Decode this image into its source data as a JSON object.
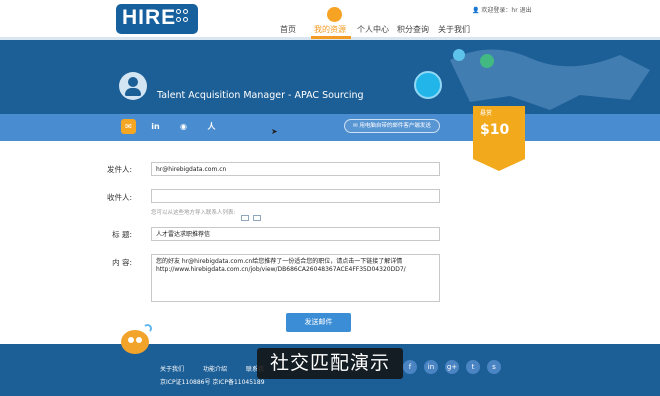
{
  "header": {
    "logo_text": "HIRE",
    "user_bar": "欢迎登录：hr  退出",
    "nav": [
      {
        "label": "首页"
      },
      {
        "label": "我的资源",
        "active": true
      },
      {
        "label": "个人中心"
      },
      {
        "label": "积分查询"
      },
      {
        "label": "关于我们"
      }
    ]
  },
  "banner": {
    "job_title": "Talent Acquisition Manager - APAC Sourcing"
  },
  "share_tabs": [
    {
      "icon": "mail-icon",
      "glyph": "✉"
    },
    {
      "icon": "linkedin-icon",
      "glyph": "in"
    },
    {
      "icon": "weibo-icon",
      "glyph": "◉"
    },
    {
      "icon": "renren-icon",
      "glyph": "人"
    }
  ],
  "mail_client_button": "用电脑自带的邮件客户端发送",
  "reward": {
    "label": "悬赏",
    "value": "$10"
  },
  "form": {
    "sender_label": "发件人:",
    "sender_value": "hr@hirebigdata.com.cn",
    "recipient_label": "收件人:",
    "recipient_value": "",
    "recipient_hint": "您可以从这些地方导入联系人列表:",
    "subject_label": "标 题:",
    "subject_value": "人才雷达求职推荐信",
    "content_label": "内 容:",
    "content_line1": "您的好友 hr@hirebigdata.com.cn给您推荐了一份适合您的职位，请点击一下链接了解详情",
    "content_line2": "http://www.hirebigdata.com.cn/job/view/DB686CA26048367ACE4FF35D04320DD7/",
    "send_button": "发送邮件"
  },
  "footer": {
    "links": [
      "关于我们",
      "功能介绍",
      "联系我"
    ],
    "icp": "京ICP证110886号 京ICP备11045189"
  },
  "social_icons": [
    {
      "icon": "facebook-icon",
      "glyph": "f"
    },
    {
      "icon": "linkedin-footer-icon",
      "glyph": "in"
    },
    {
      "icon": "googleplus-icon",
      "glyph": "g+"
    },
    {
      "icon": "twitter-icon",
      "glyph": "t"
    },
    {
      "icon": "skype-icon",
      "glyph": "s"
    }
  ],
  "subtitle_overlay": "社交匹配演示",
  "colors": {
    "brand_blue": "#1c5e96",
    "accent_orange": "#f29a21",
    "tab_blue": "#4a8cd0",
    "button_blue": "#3b8dd6"
  }
}
